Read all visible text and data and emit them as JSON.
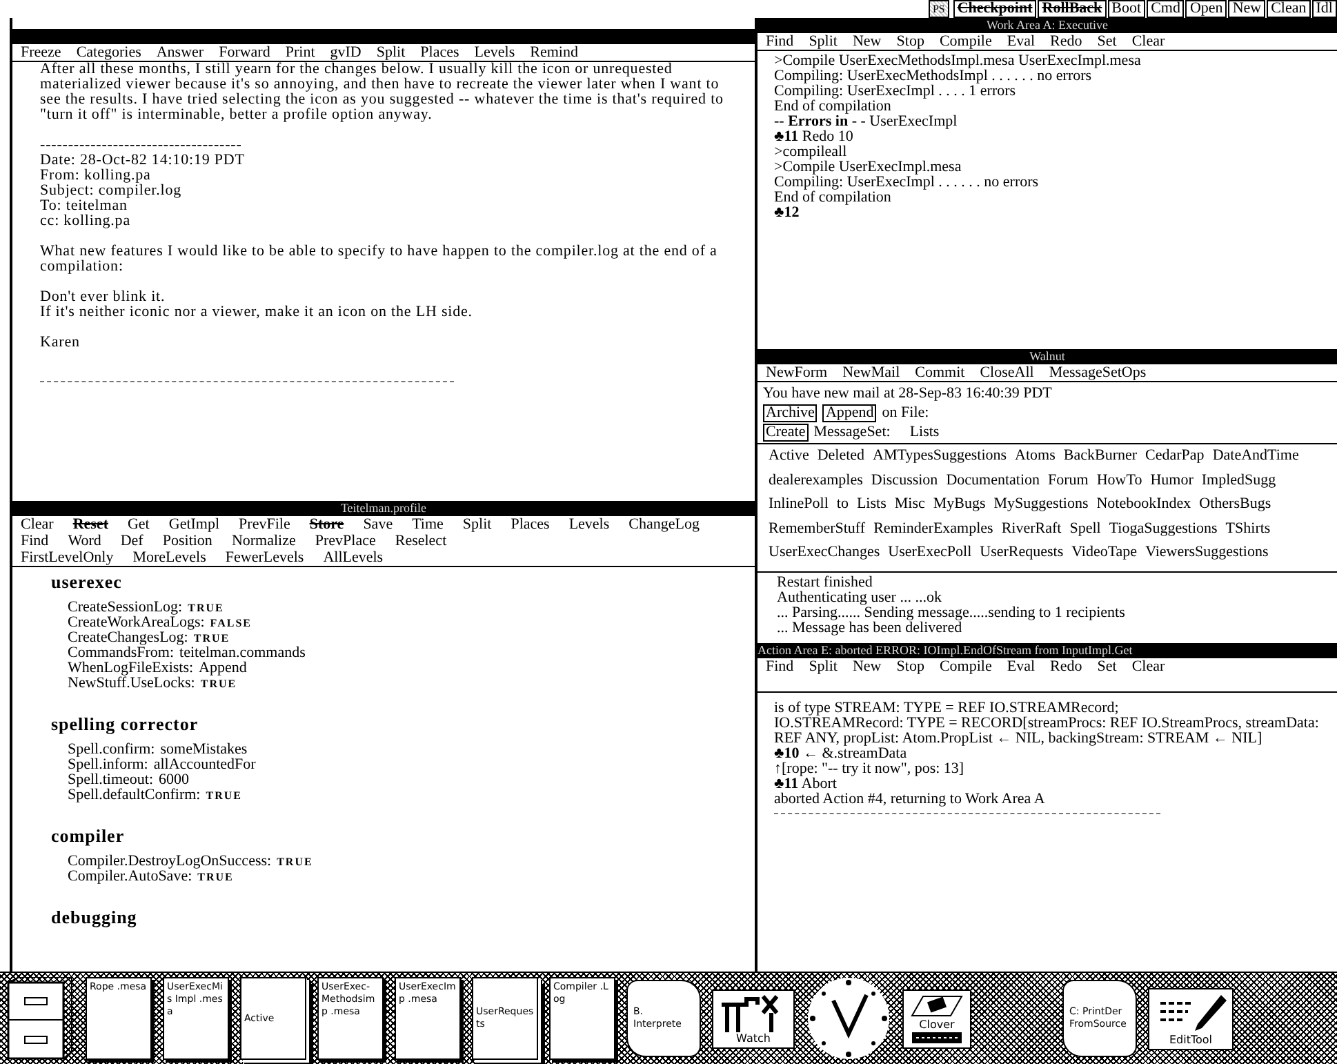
{
  "top_bar": {
    "buttons": [
      {
        "label": "Checkpoint",
        "struck": true
      },
      {
        "label": "RollBack",
        "struck": true
      },
      {
        "label": "Boot",
        "struck": false
      },
      {
        "label": "Cmd",
        "struck": false
      },
      {
        "label": "Open",
        "struck": false
      },
      {
        "label": "New",
        "struck": false
      },
      {
        "label": "Clean",
        "struck": false
      },
      {
        "label": "Idl",
        "struck": false
      }
    ],
    "ps_label": "PS"
  },
  "mail_viewer": {
    "menu": [
      {
        "label": "Freeze",
        "struck": false
      },
      {
        "label": "Categories",
        "struck": false
      },
      {
        "label": "Answer",
        "struck": false
      },
      {
        "label": "Forward",
        "struck": false
      },
      {
        "label": "Print",
        "struck": false
      },
      {
        "label": "gvID",
        "struck": false
      },
      {
        "label": "Split",
        "struck": false
      },
      {
        "label": "Places",
        "struck": false
      },
      {
        "label": "Levels",
        "struck": false
      },
      {
        "label": "Remind",
        "struck": false
      }
    ],
    "paragraphs": [
      [
        "After all these months, I still yearn for the changes below.  I usually kill the icon or unrequested materialized viewer because it's so annoying, and then have to recreate the viewer later when I want to see the results.  I have tried selecting the icon as you suggested -- whatever the time is that's required to \"turn it off\" is interminable, better a profile option anyway."
      ],
      [
        "------------------------------------",
        "Date: 28-Oct-82 14:10:19 PDT",
        "From: kolling.pa",
        "Subject: compiler.log",
        "To: teitelman",
        "cc: kolling.pa"
      ],
      [
        "What new features I would like to be able to specify to have happen to the compiler.log at the end of a compilation:"
      ],
      [
        "Don't ever blink it.",
        "If it's neither iconic nor a viewer, make it an icon on the LH side."
      ],
      [
        "Karen"
      ]
    ]
  },
  "profile_viewer": {
    "title": "Teitelman.profile",
    "menu_rows": [
      [
        {
          "label": "Clear",
          "struck": false
        },
        {
          "label": "Reset",
          "struck": true
        },
        {
          "label": "Get",
          "struck": false
        },
        {
          "label": "GetImpl",
          "struck": false
        },
        {
          "label": "PrevFile",
          "struck": false
        },
        {
          "label": "Store",
          "struck": true
        },
        {
          "label": "Save",
          "struck": false
        },
        {
          "label": "Time",
          "struck": false
        },
        {
          "label": "Split",
          "struck": false
        },
        {
          "label": "Places",
          "struck": false
        },
        {
          "label": "Levels",
          "struck": false
        },
        {
          "label": "ChangeLog",
          "struck": false
        }
      ],
      [
        {
          "label": "Find",
          "struck": false
        },
        {
          "label": "Word",
          "struck": false
        },
        {
          "label": "Def",
          "struck": false
        },
        {
          "label": "Position",
          "struck": false
        },
        {
          "label": "Normalize",
          "struck": false
        },
        {
          "label": "PrevPlace",
          "struck": false
        },
        {
          "label": "Reselect",
          "struck": false
        }
      ],
      [
        {
          "label": "FirstLevelOnly",
          "struck": false
        },
        {
          "label": "MoreLevels",
          "struck": false
        },
        {
          "label": "FewerLevels",
          "struck": false
        },
        {
          "label": "AllLevels",
          "struck": false
        }
      ]
    ],
    "sections": [
      {
        "heading": "userexec",
        "entries": [
          {
            "key": "CreateSessionLog:",
            "value": "TRUE",
            "kind": "bool"
          },
          {
            "key": "CreateWorkAreaLogs:",
            "value": "FALSE",
            "kind": "bool"
          },
          {
            "key": "CreateChangesLog:",
            "value": "TRUE",
            "kind": "bool"
          },
          {
            "key": "CommandsFrom:",
            "value": "teitelman.commands",
            "kind": "text"
          },
          {
            "key": "WhenLogFileExists:",
            "value": "Append",
            "kind": "text"
          },
          {
            "key": "NewStuff.UseLocks:",
            "value": "TRUE",
            "kind": "bool"
          }
        ]
      },
      {
        "heading": "spelling corrector",
        "entries": [
          {
            "key": "Spell.confirm:",
            "value": "someMistakes",
            "kind": "text"
          },
          {
            "key": "Spell.inform:",
            "value": "allAccountedFor",
            "kind": "text"
          },
          {
            "key": "Spell.timeout:",
            "value": "6000",
            "kind": "text"
          },
          {
            "key": "Spell.defaultConfirm:",
            "value": "TRUE",
            "kind": "bool"
          }
        ]
      },
      {
        "heading": "compiler",
        "entries": [
          {
            "key": "Compiler.DestroyLogOnSuccess:",
            "value": "TRUE",
            "kind": "bool"
          },
          {
            "key": "Compiler.AutoSave:",
            "value": "TRUE",
            "kind": "bool"
          }
        ]
      },
      {
        "heading": "debugging"
      }
    ]
  },
  "work_area": {
    "title": "Work Area A: Executive",
    "menu": [
      {
        "label": "Find",
        "struck": false
      },
      {
        "label": "Split",
        "struck": false
      },
      {
        "label": "New",
        "struck": false
      },
      {
        "label": "Stop",
        "struck": false
      },
      {
        "label": "Compile",
        "struck": false
      },
      {
        "label": "Eval",
        "struck": false
      },
      {
        "label": "Redo",
        "struck": false
      },
      {
        "label": "Set",
        "struck": false
      },
      {
        "label": "Clear",
        "struck": false
      }
    ],
    "lines": [
      ">Compile UserExecMethodsImpl.mesa UserExecImpl.mesa",
      "Compiling: UserExecMethodsImpl . . . . . . no errors",
      "Compiling: UserExecImpl . . . . 1 errors",
      "End of compilation",
      "-- **Errors in** - - UserExecImpl",
      "**♣11** Redo 10",
      ">compileall",
      ">Compile UserExecImpl.mesa",
      "Compiling: UserExecImpl . . . . . . no errors",
      "End of compilation",
      "**♣12**"
    ]
  },
  "walnut": {
    "title": "Walnut",
    "menu": [
      {
        "label": "NewForm",
        "struck": false
      },
      {
        "label": "NewMail",
        "struck": false
      },
      {
        "label": "Commit",
        "struck": false
      },
      {
        "label": "CloseAll",
        "struck": false
      },
      {
        "label": "MessageSetOps",
        "struck": false
      }
    ],
    "new_mail": "You have new mail at 28-Sep-83 16:40:39 PDT",
    "file_buttons": [
      "Archive",
      "Append"
    ],
    "file_label": "on File:",
    "create_button": "Create",
    "messageset_label": "MessageSet:",
    "lists_label": "Lists",
    "message_sets": [
      "Active",
      "Deleted",
      "AMTypesSuggestions",
      "Atoms",
      "BackBurner",
      "CedarPap",
      "DateAndTime",
      "dealerexamples",
      "Discussion",
      "Documentation",
      "Forum",
      "HowTo",
      "Humor",
      "ImpledSugg",
      "InlinePoll",
      "to",
      "Lists",
      "Misc",
      "MyBugs",
      "MySuggestions",
      "NotebookIndex",
      "OthersBugs",
      "RememberStuff",
      "ReminderExamples",
      "RiverRaft",
      "Spell",
      "TiogaSuggestions",
      "TShirts",
      "UserExecChanges",
      "UserExecPoll",
      "UserRequests",
      "VideoTape",
      "ViewersSuggestions"
    ],
    "log": [
      "Restart finished",
      "Authenticating user ... ...ok",
      "... Parsing...... Sending message.....sending to 1 recipients",
      "... Message has been delivered"
    ]
  },
  "action_area": {
    "title": "Action Area E: aborted ERROR: IOImpl.EndOfStream from InputImpl.Get",
    "menu": [
      {
        "label": "Find",
        "struck": false
      },
      {
        "label": "Split",
        "struck": false
      },
      {
        "label": "New",
        "struck": false
      },
      {
        "label": "Stop",
        "struck": false
      },
      {
        "label": "Compile",
        "struck": false
      },
      {
        "label": "Eval",
        "struck": false
      },
      {
        "label": "Redo",
        "struck": false
      },
      {
        "label": "Set",
        "struck": false
      },
      {
        "label": "Clear",
        "struck": false
      }
    ],
    "lines": [
      "is of type STREAM: TYPE = REF IO.STREAMRecord;",
      "IO.STREAMRecord: TYPE = RECORD[streamProcs: REF IO.StreamProcs, streamData: REF ANY, propList: Atom.PropList ← NIL, backingStream: STREAM ← NIL]",
      "**♣10** ← &.streamData",
      "↑[rope: \"-- try it now\", pos: 13]",
      "**♣11** Abort",
      "aborted Action #4, returning to Work Area A"
    ]
  },
  "icons": [
    {
      "kind": "cabinet"
    },
    {
      "kind": "doc",
      "label": "Rope .mesa"
    },
    {
      "kind": "doc",
      "label": "UserExecMis Impl .mesa"
    },
    {
      "kind": "stack",
      "label": "Active"
    },
    {
      "kind": "doc",
      "label": "UserExec- Methodsimp .mesa"
    },
    {
      "kind": "doc",
      "label": "UserExecImp .mesa"
    },
    {
      "kind": "stack",
      "label": "UserRequests"
    },
    {
      "kind": "doc",
      "label": "Compiler .Log"
    },
    {
      "kind": "scroll",
      "label": "B. Interprete"
    },
    {
      "kind": "tools",
      "label": "Watch"
    },
    {
      "kind": "clock"
    },
    {
      "kind": "printer",
      "label": "Clover"
    },
    {
      "kind": "gap"
    },
    {
      "kind": "scroll",
      "label": "C: PrintDer FromSource"
    },
    {
      "kind": "pen",
      "label": "EditTool"
    }
  ]
}
